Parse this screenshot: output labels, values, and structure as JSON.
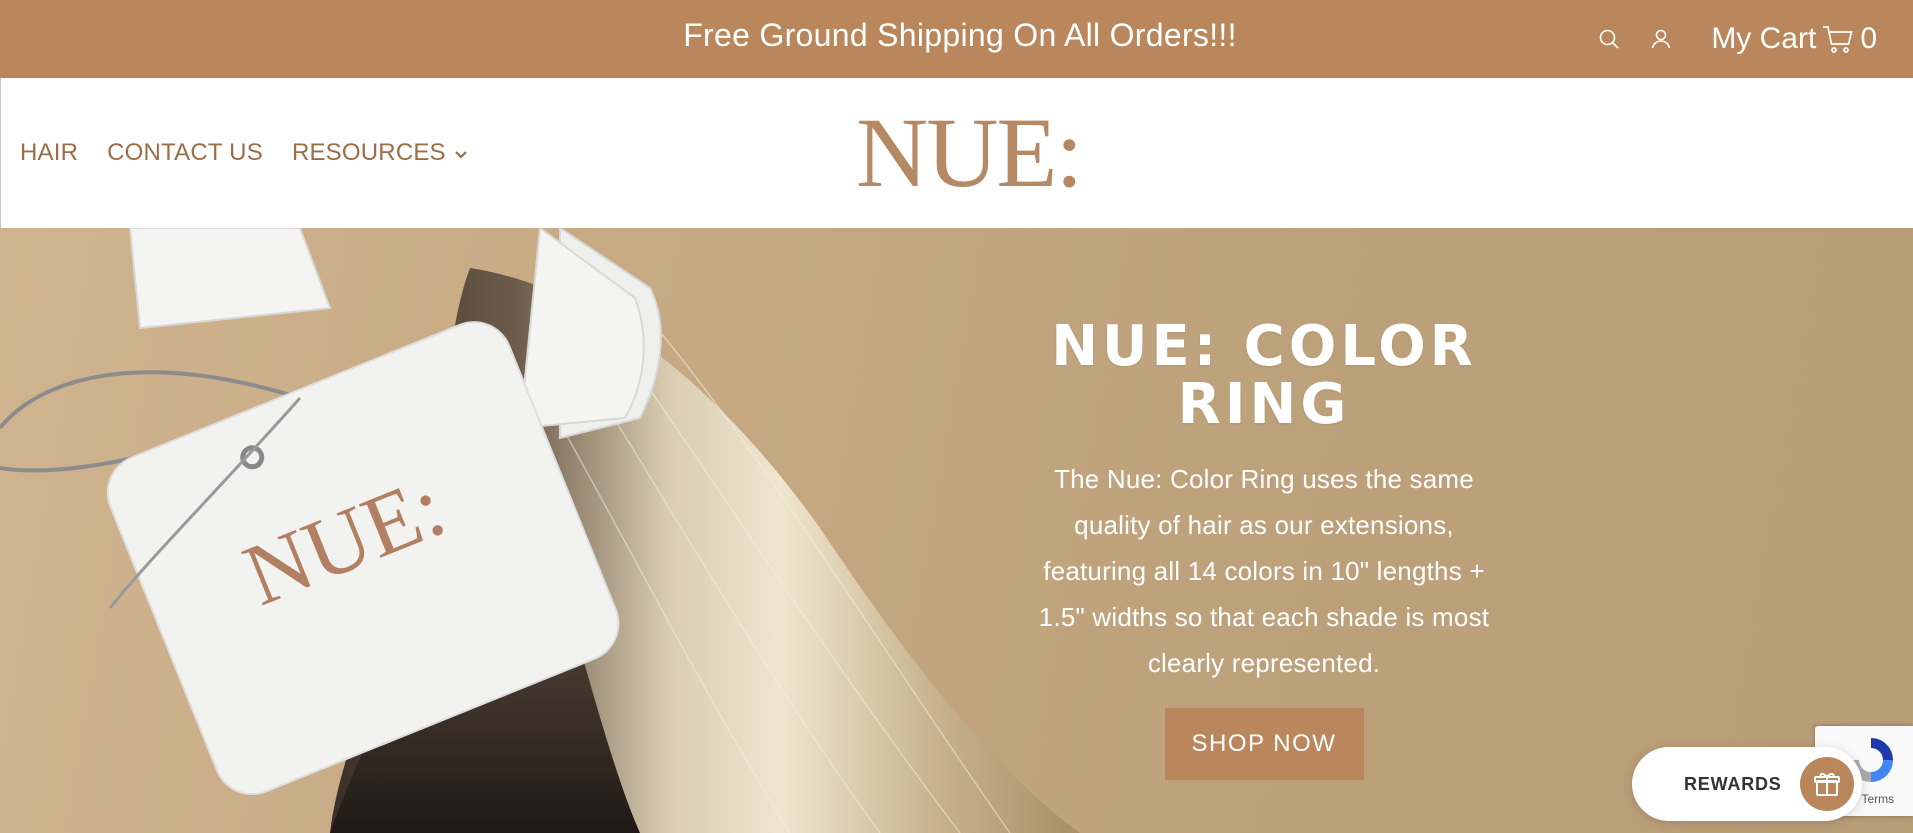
{
  "announcement": {
    "text": "Free Ground Shipping On All Orders!!!"
  },
  "utility": {
    "search_icon": "search-icon",
    "account_icon": "account-icon",
    "cart_label": "My Cart",
    "cart_icon": "cart-icon",
    "cart_count": "0"
  },
  "nav": {
    "items": [
      {
        "label": "HAIR"
      },
      {
        "label": "CONTACT US"
      },
      {
        "label": "RESOURCES",
        "has_dropdown": true
      }
    ]
  },
  "logo": {
    "text": "NUE:"
  },
  "hero": {
    "title": "NUE: COLOR RING",
    "body": "The Nue: Color Ring uses the same quality of hair as our extensions, featuring all 14 colors in 10\" lengths + 1.5\" widths so that each shade is most clearly represented.",
    "button_label": "SHOP NOW",
    "tag_text": "NUE:"
  },
  "rewards": {
    "label": "REWARDS",
    "icon": "gift-icon"
  },
  "recaptcha": {
    "links": "y - Terms"
  },
  "colors": {
    "brand": "#b9875b",
    "nav_text": "#9a6e47",
    "logo": "#b48963",
    "hero_bg": "#c6a983"
  }
}
